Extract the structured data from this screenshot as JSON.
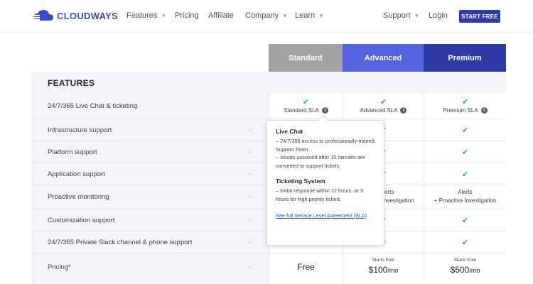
{
  "brand": {
    "name": "CLOUDWAYS"
  },
  "nav": {
    "features": "Features",
    "pricing": "Pricing",
    "affiliate": "Affiliate",
    "company": "Company",
    "learn": "Learn",
    "support": "Support",
    "login": "Login",
    "start_free": "START FREE"
  },
  "plans": {
    "standard": "Standard",
    "advanced": "Advanced",
    "premium": "Premium"
  },
  "colors": {
    "standard": "#a3a3a3",
    "advanced": "#5563e0",
    "premium": "#2f3aa8",
    "check": "#2fb34a"
  },
  "features_title": "FEATURES",
  "rows": {
    "live_chat": "24/7/365 Live Chat & ticketing",
    "infrastructure": "Infrastructure support",
    "platform": "Platform support",
    "application": "Application support",
    "proactive": "Proactive monitoring",
    "customization": "Customization support",
    "slack": "24/7/365 Private Slack channel & phone support",
    "pricing": "Pricing*"
  },
  "cells": {
    "standard_sla": "Standard SLA",
    "advanced_sla": "Advanced SLA",
    "premium_sla": "Premium SLA",
    "alerts_partial": "erts",
    "investigation_partial": "nvestigation",
    "alerts": "Alerts",
    "proactive_investigation": "+ Proactive Investigation",
    "free": "Free",
    "starts_from_adv": "Starts from",
    "price_adv": "$100",
    "mo_adv": "/mo",
    "starts_from_prem": "Starts from",
    "price_prem": "$500",
    "mo_prem": "/mo",
    "partial_t": "t"
  },
  "tooltip": {
    "live_chat_title": "Live Chat",
    "live_chat_line1": "– 24/7/365 access to professionally-trained Support Team",
    "live_chat_line2": "– Issues unsolved after 15 minutes are converted to support tickets",
    "ticketing_title": "Ticketing System",
    "ticketing_line1": "– Initial response within 12 hours, or 3 hours for high priority tickets",
    "link": "See full Service Level Agreement (SLA)"
  }
}
